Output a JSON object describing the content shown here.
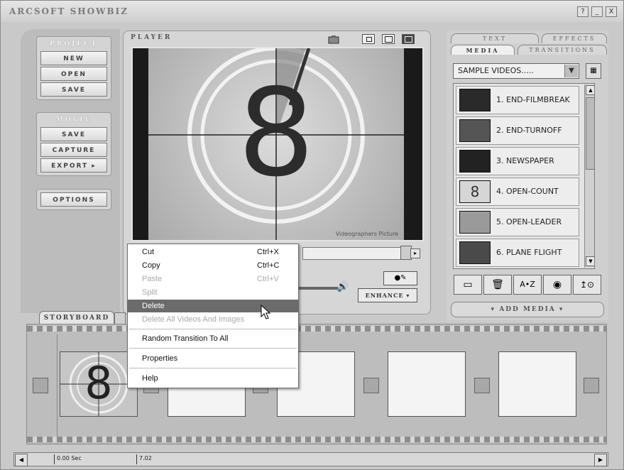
{
  "app": {
    "title": "ArcSoft ShowBiz",
    "window_buttons": [
      "?",
      "_",
      "X"
    ]
  },
  "left_panel": {
    "project": {
      "title": "Project",
      "buttons": [
        "New",
        "Open",
        "Save"
      ]
    },
    "movie": {
      "title": "Movie",
      "buttons": [
        "Save",
        "Capture",
        "Export"
      ]
    },
    "options_label": "Options"
  },
  "player": {
    "title": "Player",
    "frame_number": "8",
    "watermark": "Videographers Picture",
    "enhance_label": "Enhance"
  },
  "right_panel": {
    "tabs_top": [
      "Text",
      "Effects"
    ],
    "tabs_bottom": [
      "Media",
      "Transitions"
    ],
    "active_tab": "Media",
    "dropdown_value": "SAMPLE VIDEOS.....",
    "items": [
      {
        "label": "1. END-FILMBREAK"
      },
      {
        "label": "2. END-TURNOFF"
      },
      {
        "label": "3. NEWSPAPER"
      },
      {
        "label": "4. OPEN-COUNT",
        "thumb_text": "8"
      },
      {
        "label": "5. OPEN-LEADER"
      },
      {
        "label": "6. PLANE FLIGHT"
      }
    ],
    "tool_icons": [
      "import-icon",
      "trash-icon",
      "sort-az-icon",
      "capture-icon",
      "download-icon"
    ],
    "add_media_label": "Add Media"
  },
  "storyboard": {
    "tab_label": "Storyboard",
    "first_clip_number": "8"
  },
  "timeline": {
    "start": "0.00 Sec",
    "end": "7.02"
  },
  "context_menu": {
    "items": [
      {
        "label": "Cut",
        "shortcut": "Ctrl+X"
      },
      {
        "label": "Copy",
        "shortcut": "Ctrl+C"
      },
      {
        "label": "Paste",
        "shortcut": "Ctrl+V"
      },
      {
        "label": "Split",
        "shortcut": ""
      },
      {
        "label": "Delete",
        "shortcut": ""
      },
      {
        "label": "Delete All Videos And Images",
        "shortcut": ""
      },
      {
        "label": "Random Transition To All",
        "shortcut": ""
      },
      {
        "label": "Properties",
        "shortcut": ""
      },
      {
        "label": "Help",
        "shortcut": ""
      }
    ],
    "highlighted": "Delete"
  }
}
